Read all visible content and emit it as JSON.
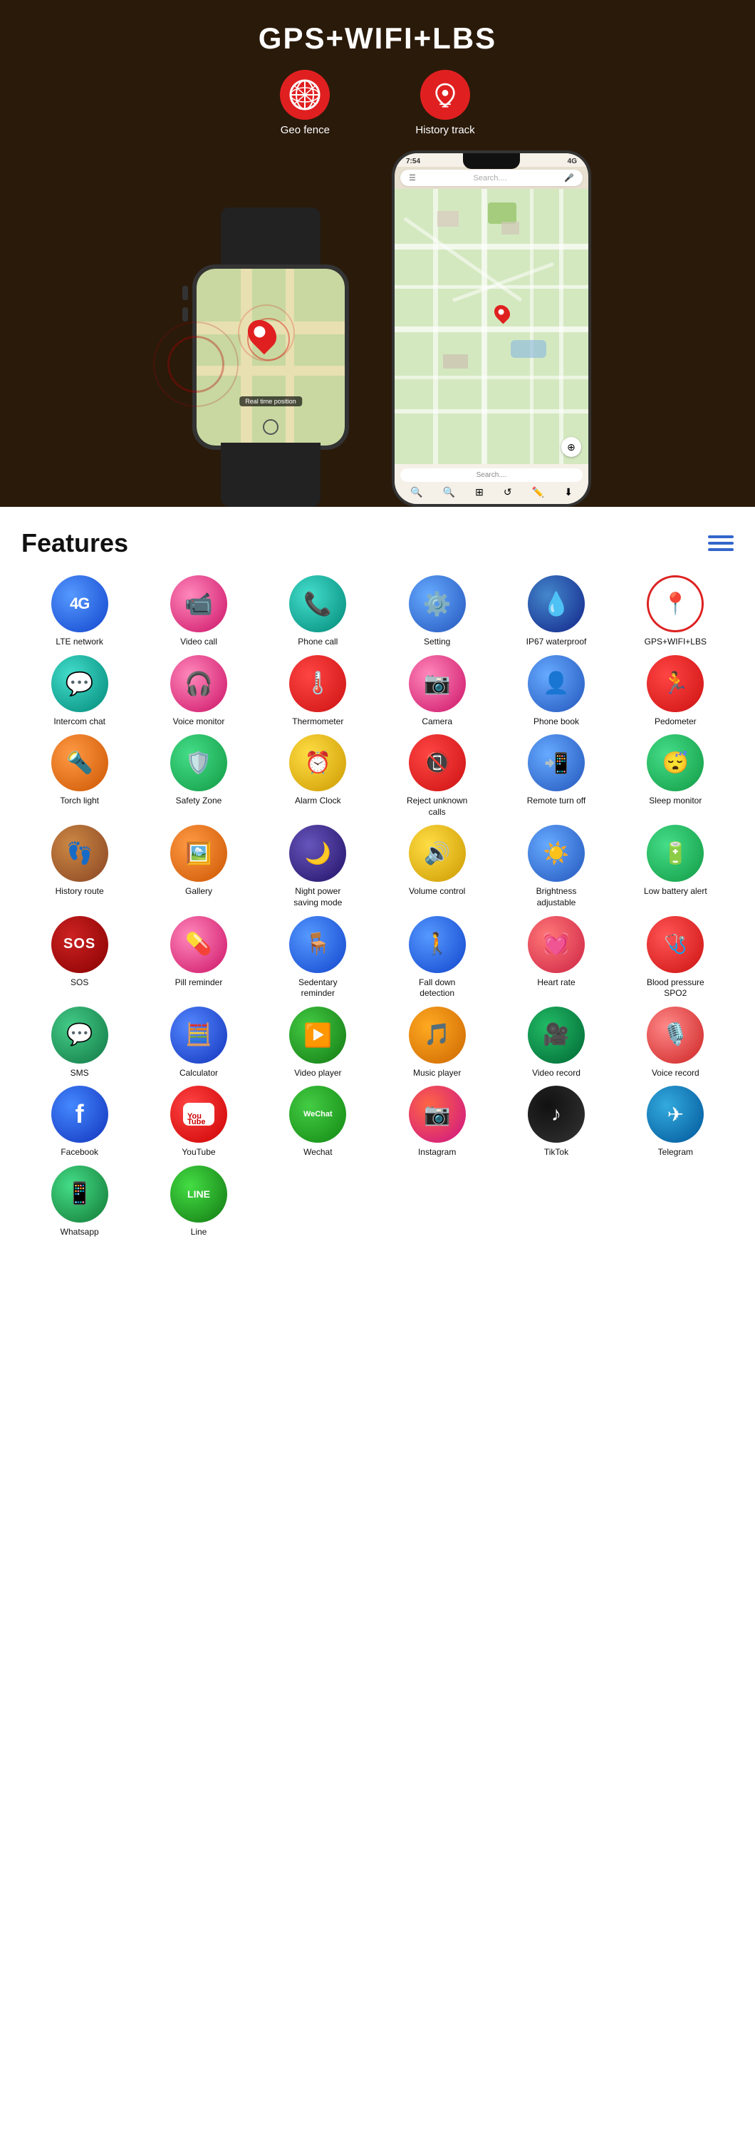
{
  "hero": {
    "title": "GPS+WIFI+LBS",
    "geo_fence_label": "Geo fence",
    "history_track_label": "History track",
    "real_time_label": "Real time position"
  },
  "features": {
    "title": "Features",
    "items": [
      {
        "id": "lte",
        "label": "LTE network",
        "icon": "4G",
        "color": "ic-blue"
      },
      {
        "id": "video-call",
        "label": "Video call",
        "icon": "📹",
        "color": "ic-pink"
      },
      {
        "id": "phone-call",
        "label": "Phone call",
        "icon": "📞",
        "color": "ic-teal"
      },
      {
        "id": "setting",
        "label": "Setting",
        "icon": "⚙️",
        "color": "ic-blue2"
      },
      {
        "id": "waterproof",
        "label": "IP67 waterproof",
        "icon": "💧",
        "color": "ic-darkblue"
      },
      {
        "id": "gps",
        "label": "GPS+WIFI+LBS",
        "icon": "📍",
        "color": "ic-red-outline"
      },
      {
        "id": "intercom",
        "label": "Intercom chat",
        "icon": "💬",
        "color": "ic-teal"
      },
      {
        "id": "voice-monitor",
        "label": "Voice monitor",
        "icon": "🎧",
        "color": "ic-pink"
      },
      {
        "id": "thermometer",
        "label": "Thermometer",
        "icon": "🌡️",
        "color": "ic-red"
      },
      {
        "id": "camera",
        "label": "Camera",
        "icon": "📷",
        "color": "ic-pink"
      },
      {
        "id": "phonebook",
        "label": "Phone book",
        "icon": "👤",
        "color": "ic-blue2"
      },
      {
        "id": "pedometer",
        "label": "Pedometer",
        "icon": "🏃",
        "color": "ic-red"
      },
      {
        "id": "torch",
        "label": "Torch light",
        "icon": "🔦",
        "color": "ic-orange"
      },
      {
        "id": "safety",
        "label": "Safety Zone",
        "icon": "🛡️",
        "color": "ic-green"
      },
      {
        "id": "alarm",
        "label": "Alarm Clock",
        "icon": "⏰",
        "color": "ic-yellow"
      },
      {
        "id": "reject",
        "label": "Reject unknown calls",
        "icon": "📵",
        "color": "ic-red"
      },
      {
        "id": "remote",
        "label": "Remote turn off",
        "icon": "📲",
        "color": "ic-blue2"
      },
      {
        "id": "sleep",
        "label": "Sleep monitor",
        "icon": "😴",
        "color": "ic-green"
      },
      {
        "id": "history",
        "label": "History route",
        "icon": "👣",
        "color": "ic-brown"
      },
      {
        "id": "gallery",
        "label": "Gallery",
        "icon": "🖼️",
        "color": "ic-orange"
      },
      {
        "id": "night",
        "label": "Night power saving mode",
        "icon": "🌙",
        "color": "ic-indigo"
      },
      {
        "id": "volume",
        "label": "Volume control",
        "icon": "🔊",
        "color": "ic-yellow"
      },
      {
        "id": "brightness",
        "label": "Brightness adjustable",
        "icon": "☀️",
        "color": "ic-blue2"
      },
      {
        "id": "battery",
        "label": "Low battery alert",
        "icon": "🔋",
        "color": "ic-green"
      },
      {
        "id": "sos",
        "label": "SOS",
        "icon": "SOS",
        "color": "ic-darkred"
      },
      {
        "id": "pill",
        "label": "Pill reminder",
        "icon": "💊",
        "color": "ic-pink"
      },
      {
        "id": "sedentary",
        "label": "Sedentary reminder",
        "icon": "🪑",
        "color": "ic-blue2"
      },
      {
        "id": "fall",
        "label": "Fall down detection",
        "icon": "🚶",
        "color": "ic-blue"
      },
      {
        "id": "heart",
        "label": "Heart rate",
        "icon": "💓",
        "color": "ic-heart"
      },
      {
        "id": "blood",
        "label": "Blood pressure SPO2",
        "icon": "🩺",
        "color": "ic-blood"
      },
      {
        "id": "sms",
        "label": "SMS",
        "icon": "💬",
        "color": "ic-sms"
      },
      {
        "id": "calc",
        "label": "Calculator",
        "icon": "🧮",
        "color": "ic-calc"
      },
      {
        "id": "video",
        "label": "Video player",
        "icon": "▶️",
        "color": "ic-vid"
      },
      {
        "id": "music",
        "label": "Music player",
        "icon": "🎵",
        "color": "ic-music"
      },
      {
        "id": "vrec",
        "label": "Video record",
        "icon": "🎥",
        "color": "ic-vrec"
      },
      {
        "id": "voicerec",
        "label": "Voice record",
        "icon": "🎙️",
        "color": "ic-voice"
      },
      {
        "id": "facebook",
        "label": "Facebook",
        "icon": "f",
        "color": "ic-fb"
      },
      {
        "id": "youtube",
        "label": "YouTube",
        "icon": "▶",
        "color": "ic-yt"
      },
      {
        "id": "wechat",
        "label": "Wechat",
        "icon": "WeChat",
        "color": "ic-wc"
      },
      {
        "id": "instagram",
        "label": "Instagram",
        "icon": "📷",
        "color": "ic-ig"
      },
      {
        "id": "tiktok",
        "label": "TikTok",
        "icon": "♪",
        "color": "ic-tt"
      },
      {
        "id": "telegram",
        "label": "Telegram",
        "icon": "✈",
        "color": "ic-tg"
      },
      {
        "id": "whatsapp",
        "label": "Whatsapp",
        "icon": "📱",
        "color": "ic-wa"
      },
      {
        "id": "line",
        "label": "Line",
        "icon": "LINE",
        "color": "ic-line"
      }
    ]
  },
  "phone": {
    "time": "7:54",
    "search_placeholder": "Search....",
    "network": "4G"
  }
}
